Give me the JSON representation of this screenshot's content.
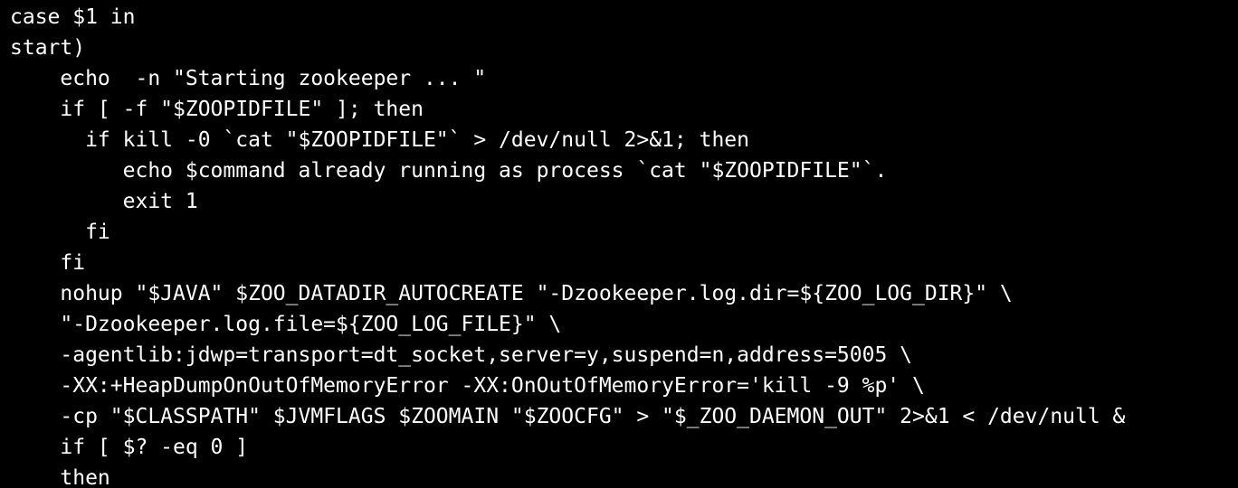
{
  "terminal": {
    "background": "#000000",
    "foreground": "#ffffff",
    "lines": [
      "case $1 in",
      "start)",
      "    echo  -n \"Starting zookeeper ... \"",
      "    if [ -f \"$ZOOPIDFILE\" ]; then",
      "      if kill -0 `cat \"$ZOOPIDFILE\"` > /dev/null 2>&1; then",
      "         echo $command already running as process `cat \"$ZOOPIDFILE\"`.",
      "         exit 1",
      "      fi",
      "    fi",
      "    nohup \"$JAVA\" $ZOO_DATADIR_AUTOCREATE \"-Dzookeeper.log.dir=${ZOO_LOG_DIR}\" \\",
      "    \"-Dzookeeper.log.file=${ZOO_LOG_FILE}\" \\",
      "    -agentlib:jdwp=transport=dt_socket,server=y,suspend=n,address=5005 \\",
      "    -XX:+HeapDumpOnOutOfMemoryError -XX:OnOutOfMemoryError='kill -9 %p' \\",
      "    -cp \"$CLASSPATH\" $JVMFLAGS $ZOOMAIN \"$ZOOCFG\" > \"$_ZOO_DAEMON_OUT\" 2>&1 < /dev/null &",
      "    if [ $? -eq 0 ]",
      "    then"
    ]
  }
}
